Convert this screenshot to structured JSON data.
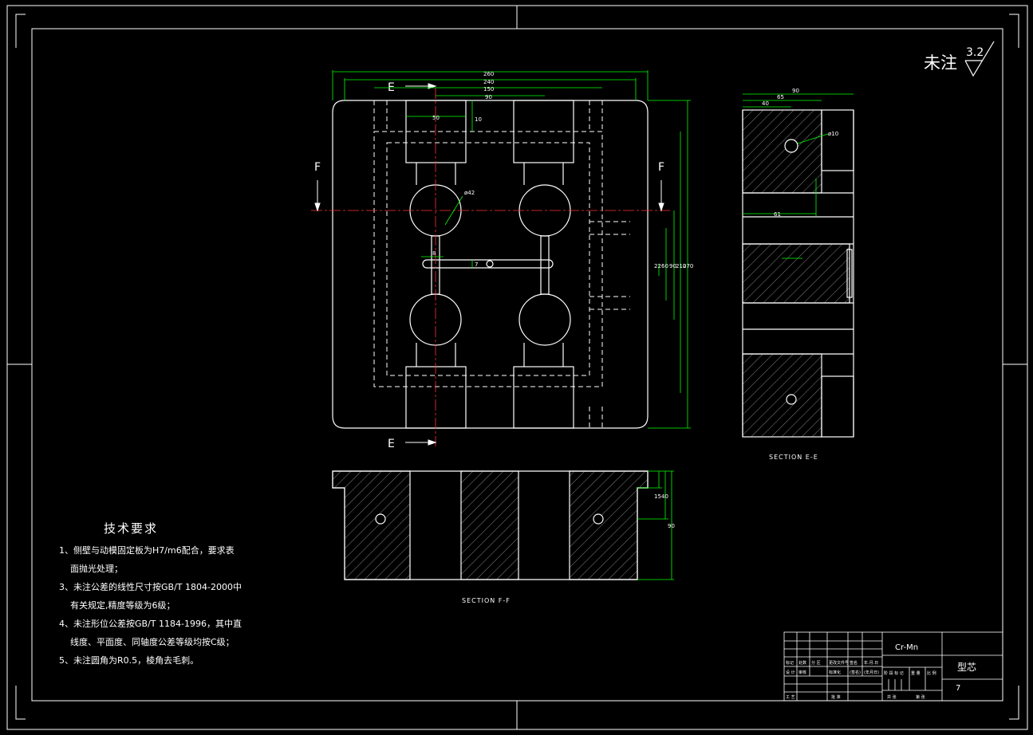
{
  "colors": {
    "background": "#000000",
    "line": "#ffffff",
    "dimension": "#00ff00",
    "section": "#ff0000"
  },
  "surface_note": {
    "text": "未注",
    "roughness": "3.2"
  },
  "section_marks": {
    "e": "E",
    "f": "F"
  },
  "views": {
    "section_ee": "SECTION E-E",
    "section_ff": "SECTION F-F"
  },
  "dimensions_top": [
    "260",
    "240",
    "150",
    "90",
    "50",
    "10",
    "ø42",
    "8",
    "7",
    "22",
    "60",
    "90",
    "210",
    "270"
  ],
  "dimensions_right": [
    "90",
    "65",
    "40",
    "ø10",
    "61"
  ],
  "dimensions_bottom": [
    "15",
    "40",
    "90"
  ],
  "tech_requirements": {
    "title": "技术要求",
    "items": [
      "1、侧壁与动模固定板为H7/m6配合，要求表",
      "面抛光处理；",
      "3、未注公差的线性尺寸按GB/T 1804-2000中",
      "有关规定,精度等级为6级；",
      "4、未注形位公差按GB/T 1184-1996，其中直",
      "线度、平面度、同轴度公差等级均按C级；",
      "5、未注圆角为R0.5，棱角去毛刺。"
    ]
  },
  "title_block": {
    "material": "Cr-Mn",
    "part_name": "型芯",
    "number": "7",
    "labels": [
      "标记",
      "处数",
      "分 区",
      "更改文件号",
      "签名",
      "年.月.日",
      "设 计",
      "审核",
      "标准化",
      "(签名)",
      "(年月日)",
      "阶 段 标 记",
      "重 量",
      "比 例",
      "工 艺",
      "批 准",
      "共  张",
      "第  张"
    ]
  }
}
